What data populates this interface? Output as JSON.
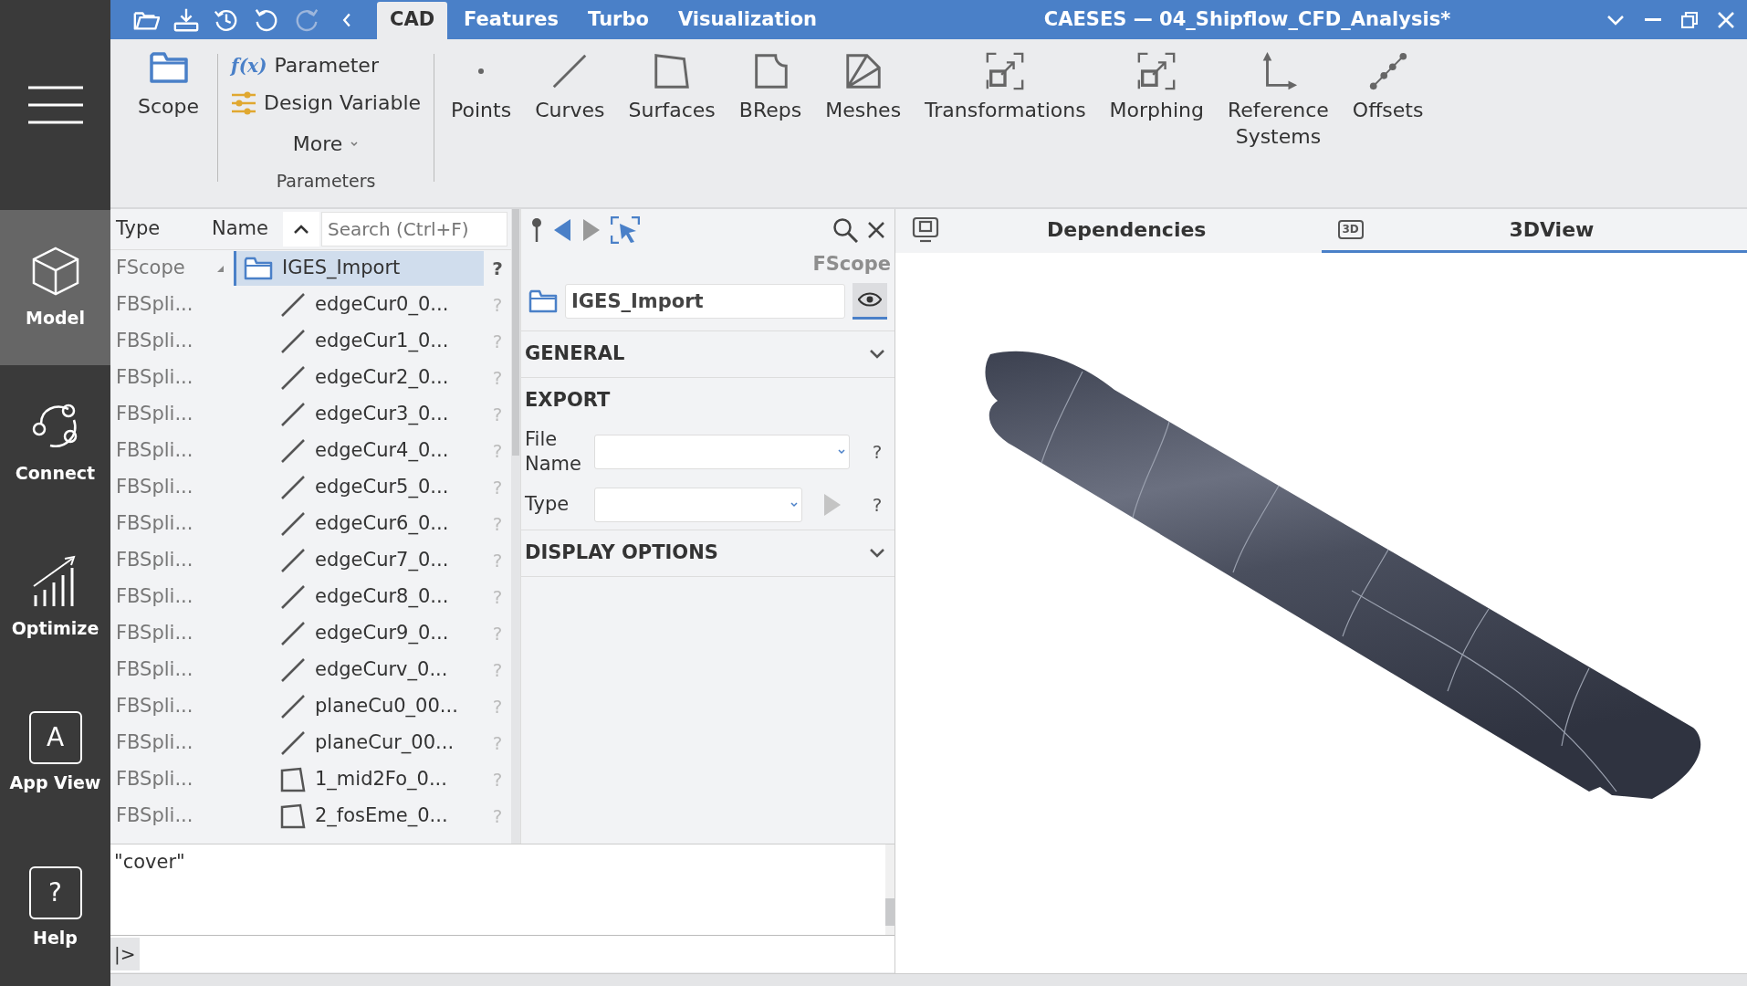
{
  "window": {
    "title": "CAESES — 04_Shipflow_CFD_Analysis*"
  },
  "quick_access": [
    {
      "kind": "open",
      "disabled": false
    },
    {
      "kind": "save",
      "disabled": false
    },
    {
      "kind": "history",
      "disabled": false
    },
    {
      "kind": "undo",
      "disabled": false
    },
    {
      "kind": "redo",
      "disabled": true
    },
    {
      "kind": "back",
      "disabled": false
    }
  ],
  "tabs": [
    {
      "label": "CAD",
      "selected": true
    },
    {
      "label": "Features",
      "selected": false
    },
    {
      "label": "Turbo",
      "selected": false
    },
    {
      "label": "Visualization",
      "selected": false
    }
  ],
  "sidebar": {
    "items": [
      {
        "kind": "model",
        "label": "Model",
        "selected": true
      },
      {
        "kind": "connect",
        "label": "Connect",
        "selected": false
      },
      {
        "kind": "optimize",
        "label": "Optimize",
        "selected": false
      },
      {
        "kind": "app_view",
        "label": "App View",
        "icon_text": "A",
        "selected": false
      },
      {
        "kind": "help",
        "label": "Help",
        "icon_text": "?",
        "selected": false
      }
    ]
  },
  "ribbon": {
    "scope": "Scope",
    "parameter_items": [
      {
        "kind": "parameter",
        "icon_text": "f(x)",
        "label": "Parameter"
      },
      {
        "kind": "design_variable",
        "label": "Design Variable"
      }
    ],
    "more": "More",
    "group_label": "Parameters",
    "tools": [
      {
        "kind": "point",
        "label": "Points"
      },
      {
        "kind": "curve",
        "label": "Curves"
      },
      {
        "kind": "surface",
        "label": "Surfaces"
      },
      {
        "kind": "brep",
        "label": "BReps"
      },
      {
        "kind": "mesh",
        "label": "Meshes"
      },
      {
        "kind": "transformation",
        "label": "Transformations"
      },
      {
        "kind": "morphing",
        "label": "Morphing"
      },
      {
        "kind": "reference",
        "label": "Reference Systems"
      },
      {
        "kind": "offset",
        "label": "Offsets"
      }
    ]
  },
  "tree": {
    "columns": [
      "Type",
      "Name"
    ],
    "search": {
      "placeholder": "Search (Ctrl+F)"
    },
    "rows": [
      {
        "type": "FScope",
        "name": "IGES_Import",
        "kind": "folder",
        "selected": true,
        "expanded": true,
        "help": "?",
        "children": [
          {
            "type": "FBSpli...",
            "name": "edgeCur0_0...",
            "kind": "curve",
            "selected": false,
            "help": "?"
          },
          {
            "type": "FBSpli...",
            "name": "edgeCur1_0...",
            "kind": "curve",
            "selected": false,
            "help": "?"
          },
          {
            "type": "FBSpli...",
            "name": "edgeCur2_0...",
            "kind": "curve",
            "selected": false,
            "help": "?"
          },
          {
            "type": "FBSpli...",
            "name": "edgeCur3_0...",
            "kind": "curve",
            "selected": false,
            "help": "?"
          },
          {
            "type": "FBSpli...",
            "name": "edgeCur4_0...",
            "kind": "curve",
            "selected": false,
            "help": "?"
          },
          {
            "type": "FBSpli...",
            "name": "edgeCur5_0...",
            "kind": "curve",
            "selected": false,
            "help": "?"
          },
          {
            "type": "FBSpli...",
            "name": "edgeCur6_0...",
            "kind": "curve",
            "selected": false,
            "help": "?"
          },
          {
            "type": "FBSpli...",
            "name": "edgeCur7_0...",
            "kind": "curve",
            "selected": false,
            "help": "?"
          },
          {
            "type": "FBSpli...",
            "name": "edgeCur8_0...",
            "kind": "curve",
            "selected": false,
            "help": "?"
          },
          {
            "type": "FBSpli...",
            "name": "edgeCur9_0...",
            "kind": "curve",
            "selected": false,
            "help": "?"
          },
          {
            "type": "FBSpli...",
            "name": "edgeCurv_0...",
            "kind": "curve",
            "selected": false,
            "help": "?"
          },
          {
            "type": "FBSpli...",
            "name": "planeCu0_00...",
            "kind": "curve",
            "selected": false,
            "help": "?"
          },
          {
            "type": "FBSpli...",
            "name": "planeCur_00...",
            "kind": "curve",
            "selected": false,
            "help": "?"
          },
          {
            "type": "FBSpli...",
            "name": "1_mid2Fo_0...",
            "kind": "surface",
            "selected": false,
            "help": "?"
          },
          {
            "type": "FBSpli...",
            "name": "2_fosEme_0...",
            "kind": "surface",
            "selected": false,
            "help": "?"
          }
        ]
      }
    ]
  },
  "properties": {
    "type_label": "FScope",
    "name": "IGES_Import",
    "visible": true,
    "sections": [
      {
        "title": "GENERAL",
        "expanded": false
      },
      {
        "title": "EXPORT",
        "expanded": true,
        "fields": [
          {
            "kind": "combo",
            "label": "File Name",
            "help": "?"
          },
          {
            "kind": "combo_run",
            "label": "Type",
            "help": "?"
          }
        ]
      },
      {
        "title": "DISPLAY OPTIONS",
        "expanded": false
      }
    ]
  },
  "view_tabs": [
    {
      "kind": "dependencies",
      "label": "Dependencies",
      "selected": false
    },
    {
      "kind": "view3d",
      "label": "3DView",
      "icon_text": "3D",
      "selected": true
    }
  ],
  "console": {
    "output": "\"cover\"",
    "prompt": "|>"
  }
}
